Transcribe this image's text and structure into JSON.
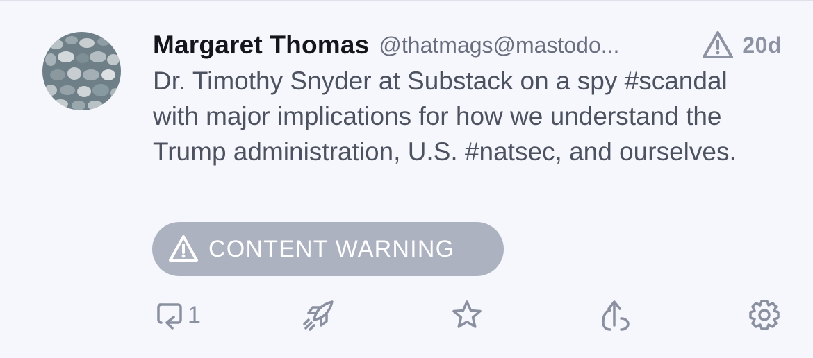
{
  "post": {
    "display_name": "Margaret Thomas",
    "handle": "@thatmags@mastodo...",
    "timestamp": "20d",
    "content": "Dr. Timothy Snyder at Substack on a spy #scandal with major implications for how we understand the Trump administration, U.S. #natsec, and ourselves.",
    "content_warning_label": "CONTENT WARNING",
    "reply_count": "1"
  },
  "icons": {
    "avatar": "pebbles-photo",
    "flag": "warning-triangle-icon",
    "reply": "reply-icon",
    "boost": "rocket-icon",
    "favourite": "star-icon",
    "share": "share-icon",
    "more": "gear-icon"
  },
  "colors": {
    "background": "#f6f7fc",
    "name": "#14161d",
    "muted": "#8d93a3",
    "cw_button": "#adb2c0"
  }
}
